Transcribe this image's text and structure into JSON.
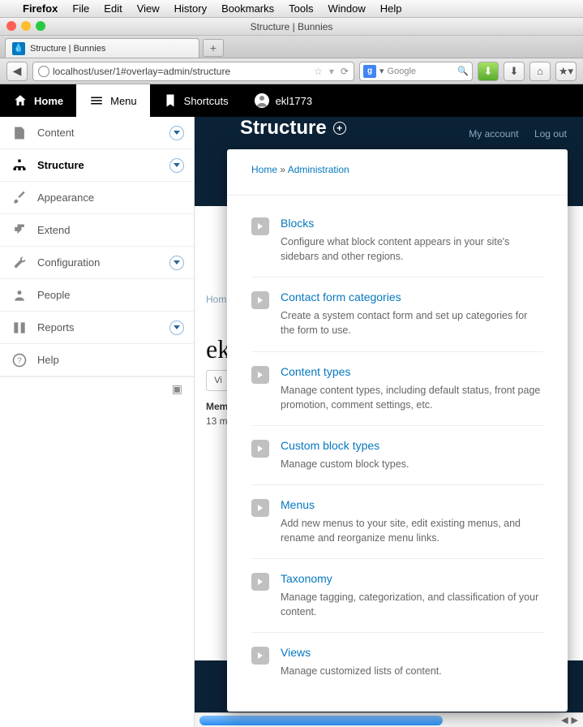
{
  "menubar": {
    "items": [
      "Firefox",
      "File",
      "Edit",
      "View",
      "History",
      "Bookmarks",
      "Tools",
      "Window",
      "Help"
    ]
  },
  "window": {
    "title": "Structure | Bunnies"
  },
  "tab": {
    "title": "Structure | Bunnies"
  },
  "urlbar": {
    "value": "localhost/user/1#overlay=admin/structure"
  },
  "search": {
    "placeholder": "Google"
  },
  "drupal_toolbar": {
    "home": "Home",
    "menu": "Menu",
    "shortcuts": "Shortcuts",
    "user": "ekl1773"
  },
  "sidebar": {
    "items": [
      {
        "label": "Content",
        "has_chevron": true
      },
      {
        "label": "Structure",
        "has_chevron": true,
        "active": true
      },
      {
        "label": "Appearance",
        "has_chevron": false
      },
      {
        "label": "Extend",
        "has_chevron": false
      },
      {
        "label": "Configuration",
        "has_chevron": true
      },
      {
        "label": "People",
        "has_chevron": false
      },
      {
        "label": "Reports",
        "has_chevron": true
      },
      {
        "label": "Help",
        "has_chevron": false
      }
    ]
  },
  "backdrop": {
    "my_account": "My account",
    "logout": "Log out",
    "home": "Hom",
    "ek": "ek",
    "vi": "Vi",
    "mem": "Mem",
    "time": "13 m"
  },
  "overlay": {
    "title": "Structure",
    "breadcrumb": {
      "home": "Home",
      "sep": " » ",
      "admin": "Administration"
    },
    "items": [
      {
        "title": "Blocks",
        "desc": "Configure what block content appears in your site's sidebars and other regions."
      },
      {
        "title": "Contact form categories",
        "desc": "Create a system contact form and set up categories for the form to use."
      },
      {
        "title": "Content types",
        "desc": "Manage content types, including default status, front page promotion, comment settings, etc."
      },
      {
        "title": "Custom block types",
        "desc": "Manage custom block types."
      },
      {
        "title": "Menus",
        "desc": "Add new menus to your site, edit existing menus, and rename and reorganize menu links."
      },
      {
        "title": "Taxonomy",
        "desc": "Manage tagging, categorization, and classification of your content."
      },
      {
        "title": "Views",
        "desc": "Manage customized lists of content."
      }
    ]
  }
}
